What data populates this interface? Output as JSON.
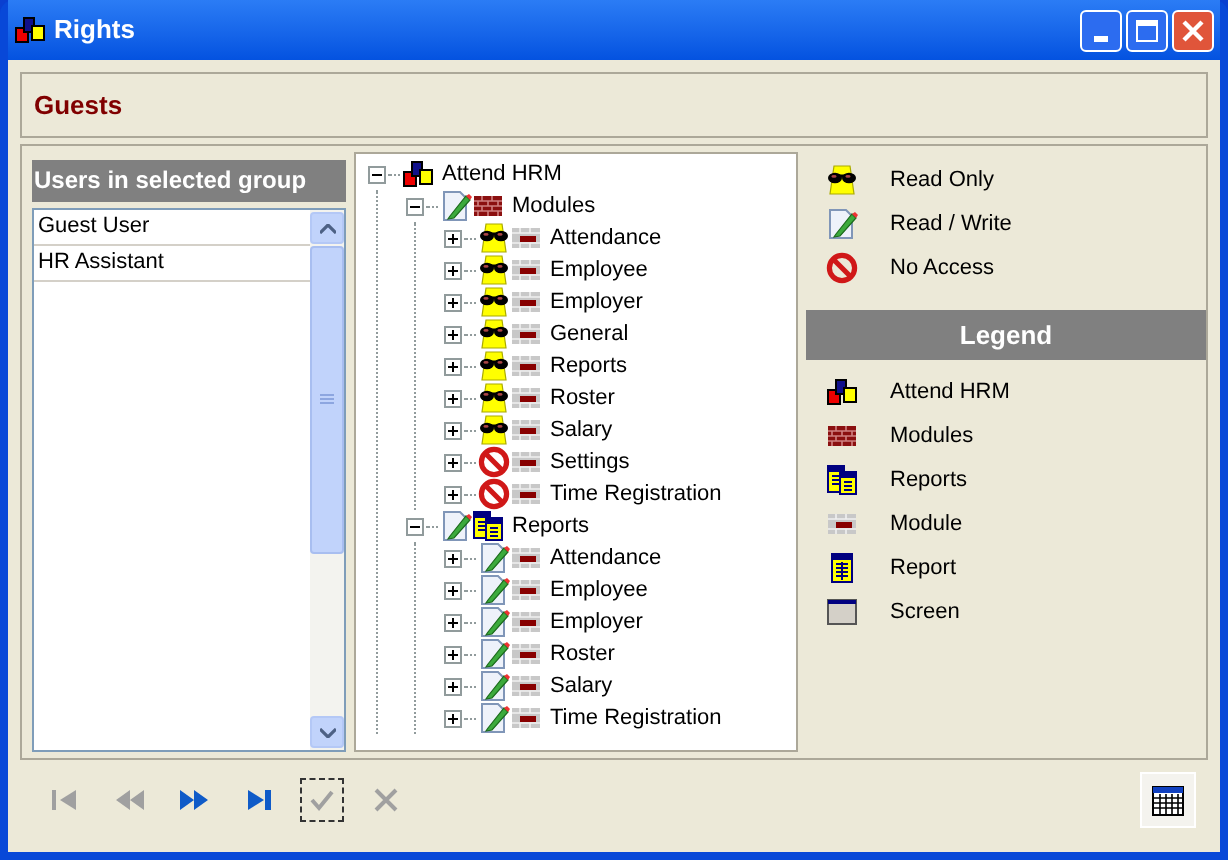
{
  "window": {
    "title": "Rights"
  },
  "group": {
    "name": "Guests"
  },
  "users": {
    "header": "Users in selected group",
    "items": [
      {
        "label": "Guest User",
        "selected": false
      },
      {
        "label": "HR Assistant",
        "selected": false
      }
    ]
  },
  "tree": [
    {
      "label": "Attend HRM",
      "kind": "app",
      "expanded": true,
      "children": [
        {
          "label": "Modules",
          "kind": "modules",
          "access": {
            "kind": "read_write"
          },
          "expanded": true,
          "children": [
            {
              "label": "Attendance",
              "kind": "module",
              "access": {
                "kind": "read_only"
              },
              "expanded": false
            },
            {
              "label": "Employee",
              "kind": "module",
              "access": {
                "kind": "read_only"
              },
              "expanded": false
            },
            {
              "label": "Employer",
              "kind": "module",
              "access": {
                "kind": "read_only"
              },
              "expanded": false
            },
            {
              "label": "General",
              "kind": "module",
              "access": {
                "kind": "read_only"
              },
              "expanded": false
            },
            {
              "label": "Reports",
              "kind": "module",
              "access": {
                "kind": "read_only"
              },
              "expanded": false
            },
            {
              "label": "Roster",
              "kind": "module",
              "access": {
                "kind": "read_only"
              },
              "expanded": false
            },
            {
              "label": "Salary",
              "kind": "module",
              "access": {
                "kind": "read_only"
              },
              "expanded": false
            },
            {
              "label": "Settings",
              "kind": "module",
              "access": {
                "kind": "no_access"
              },
              "expanded": false
            },
            {
              "label": "Time Registration",
              "kind": "module",
              "access": {
                "kind": "no_access"
              },
              "expanded": false
            }
          ]
        },
        {
          "label": "Reports",
          "kind": "reports",
          "access": {
            "kind": "read_write"
          },
          "expanded": true,
          "children": [
            {
              "label": "Attendance",
              "kind": "module",
              "access": {
                "kind": "read_write"
              },
              "expanded": false
            },
            {
              "label": "Employee",
              "kind": "module",
              "access": {
                "kind": "read_write"
              },
              "expanded": false
            },
            {
              "label": "Employer",
              "kind": "module",
              "access": {
                "kind": "read_write"
              },
              "expanded": false
            },
            {
              "label": "Roster",
              "kind": "module",
              "access": {
                "kind": "read_write"
              },
              "expanded": false
            },
            {
              "label": "Salary",
              "kind": "module",
              "access": {
                "kind": "read_write"
              },
              "expanded": false
            },
            {
              "label": "Time Registration",
              "kind": "module",
              "access": {
                "kind": "read_write"
              },
              "expanded": false
            }
          ]
        }
      ]
    }
  ],
  "access_legend": [
    {
      "kind": "read_only",
      "label": "Read Only"
    },
    {
      "kind": "read_write",
      "label": "Read / Write"
    },
    {
      "kind": "no_access",
      "label": "No Access"
    }
  ],
  "legend": {
    "title": "Legend",
    "items": [
      {
        "kind": "app",
        "label": "Attend HRM"
      },
      {
        "kind": "modules",
        "label": "Modules"
      },
      {
        "kind": "reports",
        "label": "Reports"
      },
      {
        "kind": "module",
        "label": "Module"
      },
      {
        "kind": "report",
        "label": "Report"
      },
      {
        "kind": "screen",
        "label": "Screen"
      }
    ]
  },
  "toolbar": [
    {
      "kind": "first",
      "disabled": true
    },
    {
      "kind": "prev",
      "disabled": true
    },
    {
      "kind": "next",
      "disabled": false
    },
    {
      "kind": "last",
      "disabled": false
    },
    {
      "kind": "save",
      "disabled": true
    },
    {
      "kind": "cancel",
      "disabled": true
    }
  ]
}
